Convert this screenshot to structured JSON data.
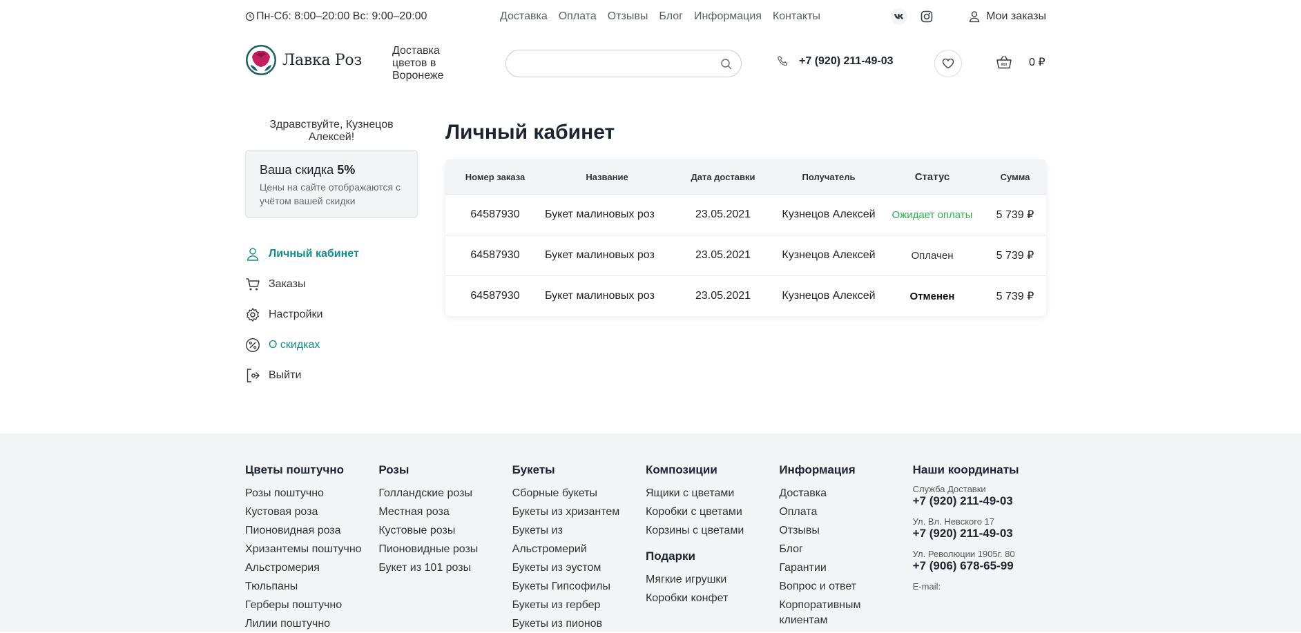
{
  "topbar": {
    "hours": "Пн-Сб: 8:00–20:00 Вс: 9:00–20:00",
    "nav": [
      "Доставка",
      "Оплата",
      "Отзывы",
      "Блог",
      "Информация",
      "Контакты"
    ],
    "my_orders": "Мои заказы"
  },
  "header": {
    "logo_text": "Лавка Роз",
    "tagline": "Доставка цветов в Воронеже",
    "search_placeholder": "",
    "phone": "+7 (920) 211-49-03",
    "cart_total": "0 ₽"
  },
  "sidebar": {
    "greeting": "Здравствуйте, Кузнецов Алексей!",
    "discount_label": "Ваша скидка",
    "discount_value": "5%",
    "discount_note": "Цены на сайте отображаются с учётом вашей скидки",
    "menu": [
      {
        "label": "Личный кабинет",
        "icon": "user-icon"
      },
      {
        "label": "Заказы",
        "icon": "cart-icon"
      },
      {
        "label": "Настройки",
        "icon": "gear-icon"
      },
      {
        "label": "О скидках",
        "icon": "percent-icon"
      },
      {
        "label": "Выйти",
        "icon": "logout-icon"
      }
    ]
  },
  "main": {
    "title": "Личный кабинет",
    "columns": [
      "Номер заказа",
      "Название",
      "Дата доставки",
      "Получатель",
      "Статус",
      "Сумма"
    ],
    "rows": [
      {
        "number": "64587930",
        "name": "Букет малиновых роз",
        "date": "23.05.2021",
        "recipient": "Кузнецов Алексей",
        "status": "Ожидает оплаты",
        "sum": "5 739 ₽"
      },
      {
        "number": "64587930",
        "name": "Букет малиновых роз",
        "date": "23.05.2021",
        "recipient": "Кузнецов Алексей",
        "status": "Оплачен",
        "sum": "5 739 ₽"
      },
      {
        "number": "64587930",
        "name": "Букет малиновых роз",
        "date": "23.05.2021",
        "recipient": "Кузнецов Алексей",
        "status": "Отменен",
        "sum": "5 739 ₽"
      }
    ]
  },
  "footer": {
    "col1": {
      "title": "Цветы поштучно",
      "links": [
        "Розы поштучно",
        "Кустовая роза",
        "Пионовидная роза",
        "Хризантемы поштучно",
        "Альстромерия",
        "Тюльпаны",
        "Герберы поштучно",
        "Лилии поштучно"
      ]
    },
    "col2": {
      "title": "Розы",
      "links": [
        "Голландские розы",
        "Местная роза",
        "Кустовые розы",
        "Пионовидные розы",
        "Букет из 101 розы"
      ]
    },
    "col3": {
      "title": "Букеты",
      "links": [
        "Сборные букеты",
        "Букеты из хризантем",
        "Букеты из Альстромерий",
        "Букеты из эустом",
        "Букеты Гипсофилы",
        "Букеты из гербер",
        "Букеты из пионов"
      ]
    },
    "col4": {
      "title": "Композиции",
      "links": [
        "Ящики с цветами",
        "Коробки с цветами",
        "Корзины с цветами"
      ],
      "title2": "Подарки",
      "links2": [
        "Мягкие игрушки",
        "Коробки конфет"
      ]
    },
    "col5": {
      "title": "Информация",
      "links": [
        "Доставка",
        "Оплата",
        "Отзывы",
        "Блог",
        "Гарантии",
        "Вопрос и ответ",
        "Корпоративным клиентам"
      ]
    },
    "col6": {
      "title": "Наши координаты",
      "contacts": [
        {
          "label": "Служба Доставки",
          "phone": "+7 (920) 211-49-03"
        },
        {
          "label": "Ул. Вл. Невского 17",
          "phone": "+7 (920) 211-49-03"
        },
        {
          "label": "Ул. Революции 1905г. 80",
          "phone": "+7 (906) 678-65-99"
        }
      ],
      "email_label": "E-mail:"
    }
  },
  "colors": {
    "accent": "#128c8e",
    "status_wait": "#2bb34a",
    "footer_bg": "#f2f4f5"
  }
}
